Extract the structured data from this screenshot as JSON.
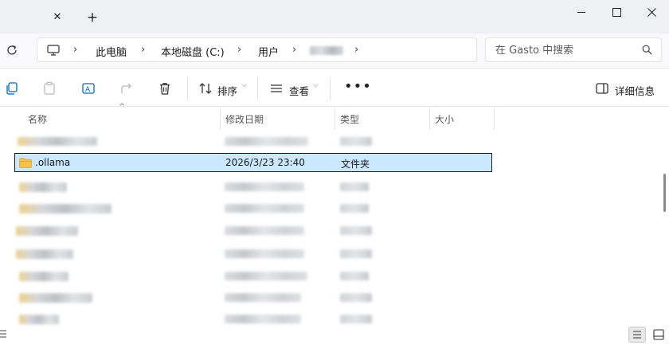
{
  "window": {
    "tab_close_icon": "close-icon",
    "tab_new_icon": "plus-icon"
  },
  "address": {
    "crumbs": [
      "此电脑",
      "本地磁盘 (C:)",
      "用户"
    ],
    "search_placeholder": "在 Gasto 中搜索"
  },
  "toolbar": {
    "sort_label": "排序",
    "view_label": "查看",
    "more_label": "•••",
    "details_label": "详细信息"
  },
  "columns": {
    "name": "名称",
    "modified": "修改日期",
    "type": "类型",
    "size": "大小"
  },
  "rows": [
    {
      "name": ".ollama",
      "modified": "2026/3/23 23:40",
      "type": "文件夹"
    }
  ],
  "colors": {
    "selection": "#cce8ff",
    "folder": "#f2c14e",
    "accent": "#0067c0"
  }
}
